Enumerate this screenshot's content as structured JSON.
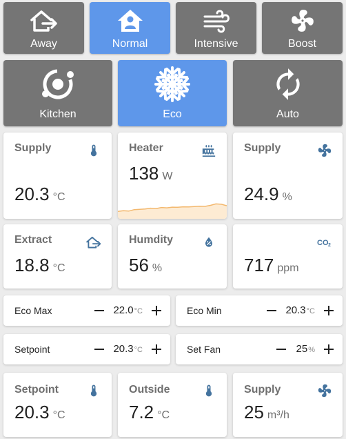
{
  "modes": {
    "away": {
      "label": "Away"
    },
    "normal": {
      "label": "Normal"
    },
    "intensive": {
      "label": "Intensive"
    },
    "boost": {
      "label": "Boost"
    },
    "kitchen": {
      "label": "Kitchen"
    },
    "eco": {
      "label": "Eco"
    },
    "auto": {
      "label": "Auto"
    }
  },
  "active_modes": [
    "Normal",
    "Eco"
  ],
  "sensors": {
    "supply_temp": {
      "title": "Supply",
      "value": "20.3",
      "unit": "°C",
      "icon": "thermometer-icon"
    },
    "heater": {
      "title": "Heater",
      "value": "138",
      "unit": "W",
      "icon": "radiator-icon"
    },
    "supply_fan": {
      "title": "Supply",
      "value": "24.9",
      "unit": "%",
      "icon": "fan-icon"
    },
    "extract": {
      "title": "Extract",
      "value": "18.8",
      "unit": "°C",
      "icon": "home-export-icon"
    },
    "humidity": {
      "title": "Humdity",
      "value": "56",
      "unit": "%",
      "icon": "water-percent-icon"
    },
    "co2": {
      "title": "",
      "value": "717",
      "unit": "ppm",
      "icon": "co2-icon"
    },
    "setpoint": {
      "title": "Setpoint",
      "value": "20.3",
      "unit": "°C",
      "icon": "thermometer-icon"
    },
    "outside": {
      "title": "Outside",
      "value": "7.2",
      "unit": "°C",
      "icon": "thermometer-icon"
    },
    "supply_flow": {
      "title": "Supply",
      "value": "25",
      "unit": "m³/h",
      "icon": "fan-icon"
    }
  },
  "numbers": {
    "eco_max": {
      "label": "Eco Max",
      "value": "22.0",
      "unit": "°C"
    },
    "eco_min": {
      "label": "Eco Min",
      "value": "20.3",
      "unit": "°C"
    },
    "setpoint": {
      "label": "Setpoint",
      "value": "20.3",
      "unit": "°C"
    },
    "set_fan": {
      "label": "Set Fan",
      "value": "25",
      "unit": "%"
    }
  },
  "heater_sparkline": [
    0.18,
    0.22,
    0.2,
    0.28,
    0.3,
    0.32,
    0.36,
    0.34,
    0.4,
    0.38,
    0.42,
    0.41,
    0.44,
    0.43,
    0.45,
    0.47,
    0.46,
    0.52,
    0.6,
    0.58,
    0.5
  ],
  "colors": {
    "accent": "#5e97ea",
    "inactive_button": "#757575",
    "icon_blue": "#44739e",
    "spark_line": "#f3b86e",
    "spark_fill": "#fdebd3"
  }
}
